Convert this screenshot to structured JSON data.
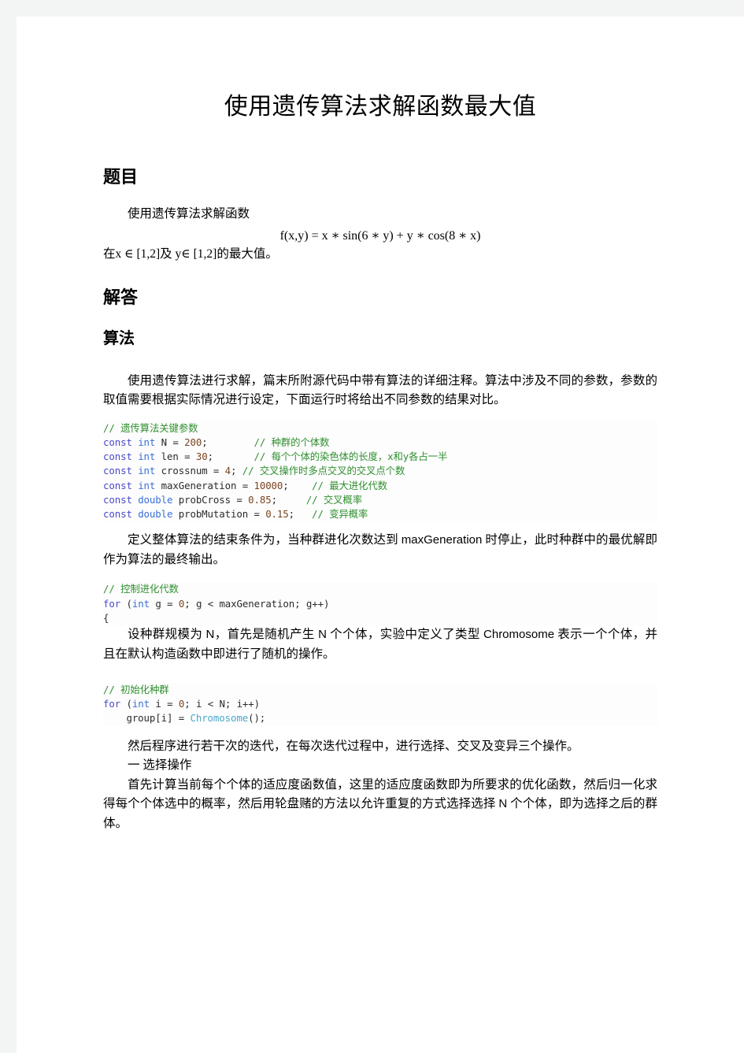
{
  "document": {
    "title": "使用遗传算法求解函数最大值"
  },
  "sections": {
    "problem": {
      "heading": "题目",
      "intro": "使用遗传算法求解函数",
      "formula": "f(x,y) = x ∗ sin(6 ∗ y) + y ∗ cos(8 ∗ x)",
      "range": "在x ∈ [1,2]及 y∈ [1,2]的最大值。"
    },
    "answer": {
      "heading": "解答"
    },
    "algorithm": {
      "heading": "算法",
      "paragraph_1": "使用遗传算法进行求解，篇末所附源代码中带有算法的详细注释。算法中涉及不同的参数，参数的取值需要根据实际情况进行设定，下面运行时将给出不同参数的结果对比。",
      "paragraph_2_before": "定义整体算法的结束条件为，当种群进化次数达到 ",
      "paragraph_2_code": "maxGeneration",
      "paragraph_2_after": " 时停止，此时种群中的最优解即作为算法的最终输出。",
      "paragraph_3_a": "设种群规模为 ",
      "paragraph_3_code1": "N",
      "paragraph_3_b": "，首先是随机产生 ",
      "paragraph_3_code2": "N",
      "paragraph_3_c": " 个个体，实验中定义了类型 ",
      "paragraph_3_code3": "Chromosome",
      "paragraph_3_d": " 表示一个个体，并且在默认构造函数中即进行了随机的操作。",
      "paragraph_4": "然后程序进行若干次的迭代，在每次迭代过程中，进行选择、交叉及变异三个操作。",
      "list_item_1": "一 选择操作",
      "paragraph_5_a": "首先计算当前每个个体的适应度函数值，这里的适应度函数即为所要求的优化函数，然后归一化求得每个个体选中的概率，然后用轮盘赌的方法以允许重复的方式选择选择 ",
      "paragraph_5_code": "N",
      "paragraph_5_b": " 个个体，即为选择之后的群体。"
    }
  },
  "code_blocks": {
    "params": {
      "comment_header": "// 遗传算法关键参数",
      "lines": [
        {
          "kw": "const",
          "ty": "int",
          "name": "N",
          "eq": "=",
          "value": "200",
          "semi": ";",
          "pad": "        ",
          "comment": "// 种群的个体数"
        },
        {
          "kw": "const",
          "ty": "int",
          "name": "len",
          "eq": "=",
          "value": "30",
          "semi": ";",
          "pad": "       ",
          "comment": "// 每个个体的染色体的长度，x和y各占一半"
        },
        {
          "kw": "const",
          "ty": "int",
          "name": "crossnum",
          "eq": "=",
          "value": "4",
          "semi": ";",
          "pad": " ",
          "comment": "// 交叉操作时多点交叉的交叉点个数"
        },
        {
          "kw": "const",
          "ty": "int",
          "name": "maxGeneration",
          "eq": "=",
          "value": "10000",
          "semi": ";",
          "pad": "    ",
          "comment": "// 最大进化代数"
        },
        {
          "kw": "const",
          "ty": "double",
          "name": "probCross",
          "eq": "=",
          "value": "0.85",
          "semi": ";",
          "pad": "     ",
          "comment": "// 交叉概率"
        },
        {
          "kw": "const",
          "ty": "double",
          "name": "probMutation",
          "eq": "=",
          "value": "0.15",
          "semi": ";",
          "pad": "   ",
          "comment": "// 变异概率"
        }
      ]
    },
    "loop": {
      "comment_header": "// 控制进化代数",
      "for_line": "for (int g = 0; g < maxGeneration; g++)",
      "brace": "{"
    },
    "init": {
      "comment_header": "// 初始化种群",
      "for_line": "for (int i = 0; i < N; i++)",
      "body_line": "    group[i] = Chromosome();"
    }
  },
  "colors": {
    "page_background": "#ffffff",
    "canvas_background": "#f3f4f4",
    "text": "#000000",
    "code_keyword": "#4b4bc8",
    "code_type": "#3a6fd8",
    "code_number": "#7a4420",
    "code_comment": "#2f8f2f",
    "code_class": "#4aa8c8"
  }
}
